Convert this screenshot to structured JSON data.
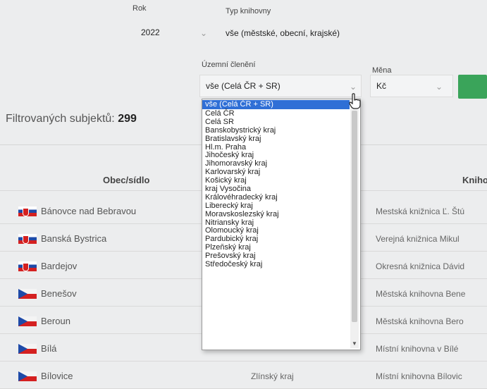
{
  "filters": {
    "rok": {
      "label": "Rok",
      "value": "2022"
    },
    "typ": {
      "label": "Typ knihovny",
      "value": "vše (městské, obecní, krajské)"
    },
    "uzemni": {
      "label": "Územní členění",
      "value": "vše (Celá ČR + SR)"
    },
    "mena": {
      "label": "Měna",
      "value": "Kč"
    }
  },
  "summary": {
    "label": "Filtrovaných subjektů:",
    "count": "299"
  },
  "table": {
    "headers": {
      "obec": "Obec/sídlo",
      "knihovna": "Kniho"
    },
    "rows": [
      {
        "flag": "sk",
        "city": "Bánovce nad Bebravou",
        "library": "Mestská knižnica Ľ. Štú"
      },
      {
        "flag": "sk",
        "city": "Banská Bystrica",
        "library": "Verejná knižnica Mikul"
      },
      {
        "flag": "sk",
        "city": "Bardejov",
        "library": "Okresná knižnica Dávid"
      },
      {
        "flag": "cz",
        "city": "Benešov",
        "library": "Městská knihovna Bene"
      },
      {
        "flag": "cz",
        "city": "Beroun",
        "library": "Městská knihovna Bero"
      },
      {
        "flag": "cz",
        "city": "Bílá",
        "library": "Místní knihovna v Bílé"
      },
      {
        "flag": "cz",
        "city": "Bílovice",
        "library": "Místní knihovna Bílovic"
      }
    ],
    "region_behind": "Zlínský kraj"
  },
  "dropdown": {
    "selected_index": 0,
    "options": [
      "vše (Celá ČR + SR)",
      "Celá ČR",
      "Celá SR",
      "Banskobystrický kraj",
      "Bratislavský kraj",
      "Hl.m. Praha",
      "Jihočeský kraj",
      "Jihomoravský kraj",
      "Karlovarský kraj",
      "Košický kraj",
      "kraj Vysočina",
      "Královéhradecký kraj",
      "Liberecký kraj",
      "Moravskoslezský kraj",
      "Nitriansky kraj",
      "Olomoucký kraj",
      "Pardubický kraj",
      "Plzeňský kraj",
      "Prešovský kraj",
      "Středočeský kraj"
    ]
  },
  "colors": {
    "selected": "#2f6fd6",
    "go_button": "#3aa45a",
    "flag_red": "#d42020",
    "flag_blue": "#1e4aa8"
  },
  "icons": {
    "chevron": "chevron-down-icon",
    "cursor": "hand-pointer-icon"
  }
}
